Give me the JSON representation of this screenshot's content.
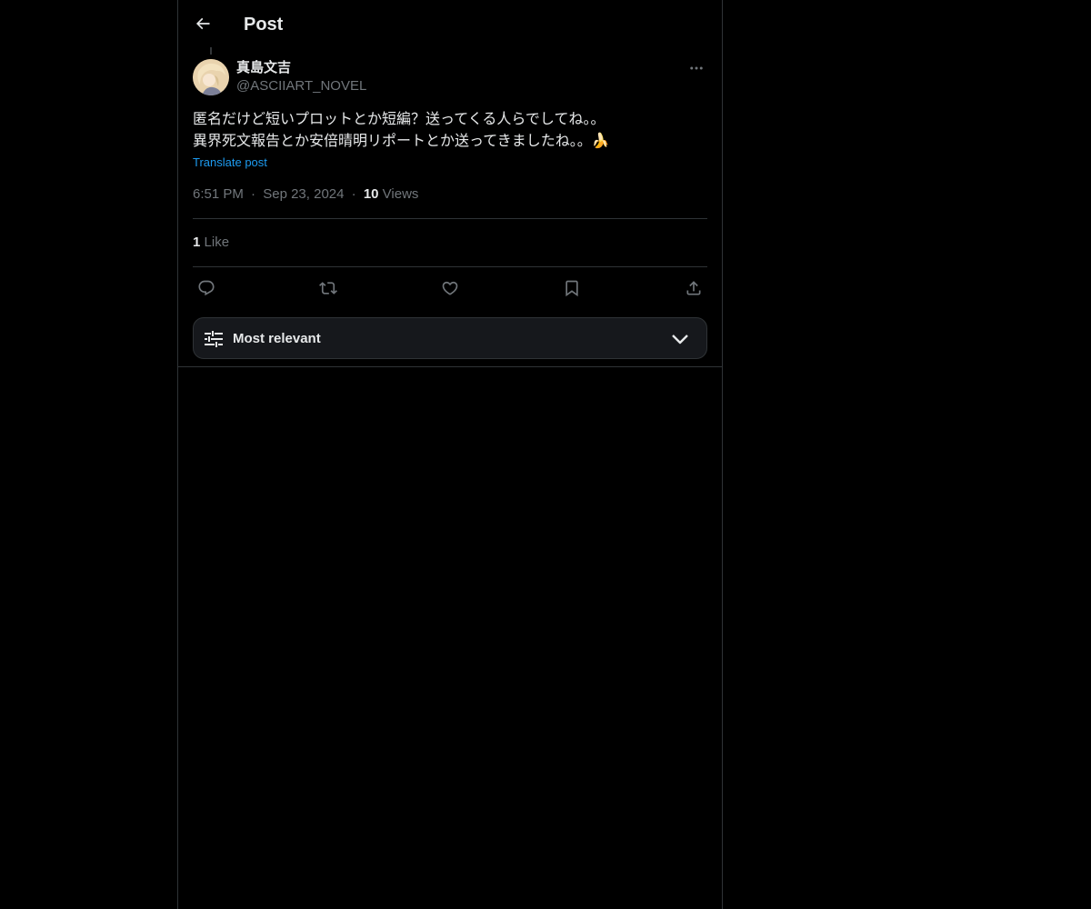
{
  "header": {
    "title": "Post",
    "back_icon": "arrow-left-icon"
  },
  "post": {
    "author": {
      "display_name": "真島文吉",
      "handle": "@ASCIIART_NOVEL"
    },
    "text_line1": "匿名だけど短いプロットとか短編？送ってくる人らでしてね。。",
    "text_line2": "異界死文報告とか安倍晴明リポートとか送ってきましたね。。🍌",
    "translate_label": "Translate post",
    "time": "6:51 PM",
    "separator": "·",
    "date": "Sep 23, 2024",
    "views_count": "10",
    "views_label": "Views",
    "likes_count": "1",
    "likes_label": "Like"
  },
  "actions": {
    "reply_icon": "reply-icon",
    "repost_icon": "repost-icon",
    "like_icon": "heart-icon",
    "bookmark_icon": "bookmark-icon",
    "share_icon": "share-icon"
  },
  "sort": {
    "label": "Most relevant"
  },
  "colors": {
    "background": "#000000",
    "text": "#e7e9ea",
    "secondary_text": "#71767b",
    "link": "#1d9bf0",
    "border": "#2f3336"
  }
}
